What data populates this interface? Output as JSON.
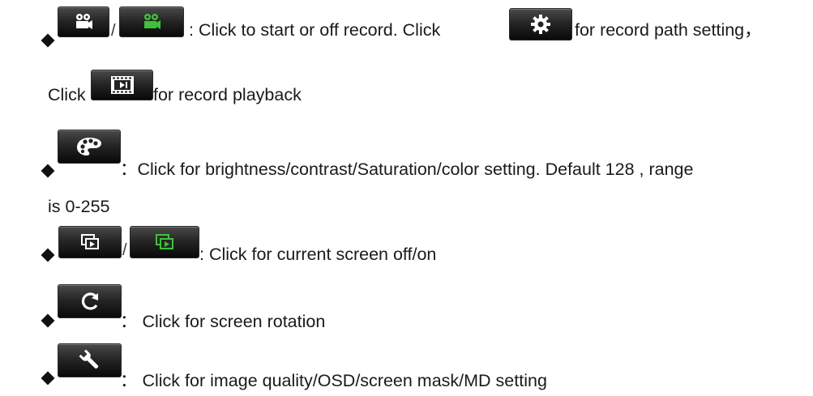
{
  "colors": {
    "text": "#1a1a1a",
    "button_dark": "#1b1b1b",
    "icon_white": "#ffffff",
    "icon_green": "#3fc23a"
  },
  "items": [
    {
      "icons": [
        "video-camera-icon",
        "video-camera-green-icon",
        "gear-icon",
        "film-playback-icon"
      ],
      "separator": "/",
      "text_1": ": Click to start or off record. Click",
      "text_2": "for record path setting，",
      "text_3": "Click",
      "text_4": "for record playback"
    },
    {
      "icons": [
        "palette-icon"
      ],
      "text_1": "：Click for brightness/contrast/Saturation/color setting. Default 128 , range",
      "text_2": "is 0-255"
    },
    {
      "icons": [
        "screen-display-icon",
        "screen-display-green-icon"
      ],
      "separator": "/",
      "text_1": ": Click for current screen off/on"
    },
    {
      "icons": [
        "rotate-icon"
      ],
      "text_1": "： Click for screen rotation"
    },
    {
      "icons": [
        "wrench-icon"
      ],
      "text_1": "： Click for image quality/OSD/screen mask/MD setting"
    }
  ]
}
